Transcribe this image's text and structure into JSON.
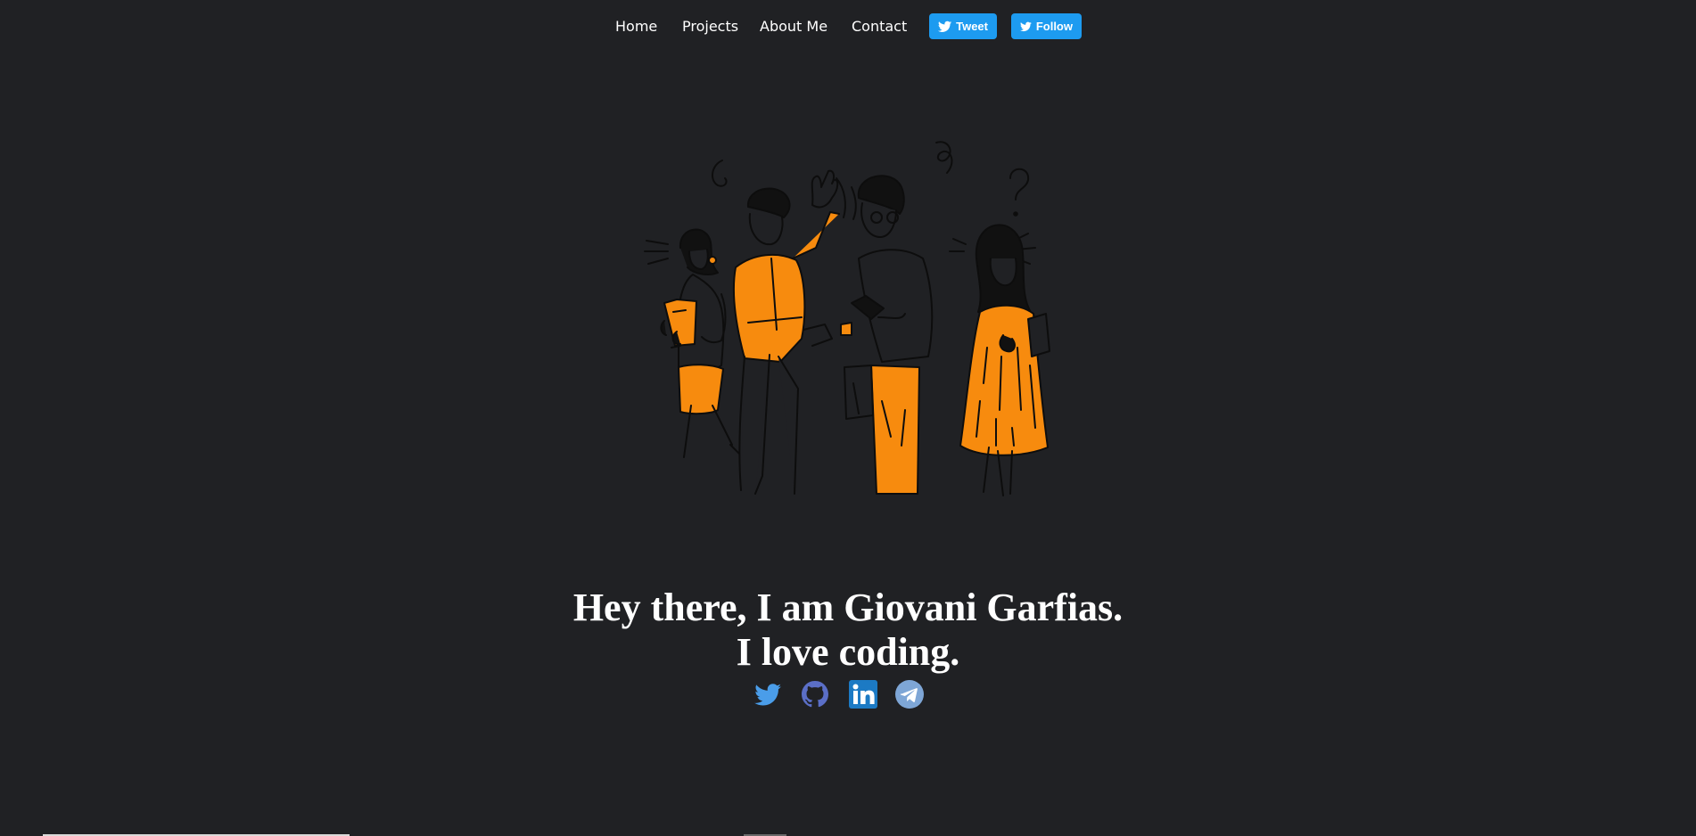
{
  "nav": {
    "home": "Home",
    "projects": "Projects",
    "about": "About Me",
    "contact": "Contact"
  },
  "twitter_buttons": {
    "tweet": "Tweet",
    "follow": "Follow"
  },
  "hero": {
    "line1": "Hey there, I am Giovani Garfias.",
    "line2": "I love coding."
  },
  "socials": [
    {
      "name": "Twitter",
      "icon": "twitter-bird-icon",
      "color": "#4a9de9"
    },
    {
      "name": "GitHub",
      "icon": "github-octocat-icon",
      "color": "#5b6fc7"
    },
    {
      "name": "LinkedIn",
      "icon": "linkedin-icon",
      "color": "#1c7ac4"
    },
    {
      "name": "Telegram",
      "icon": "telegram-plane-icon",
      "color": "#7ea6d6"
    }
  ],
  "colors": {
    "background": "#202124",
    "accent_orange": "#f78b0e",
    "twitter_blue": "#1d9bf0"
  }
}
